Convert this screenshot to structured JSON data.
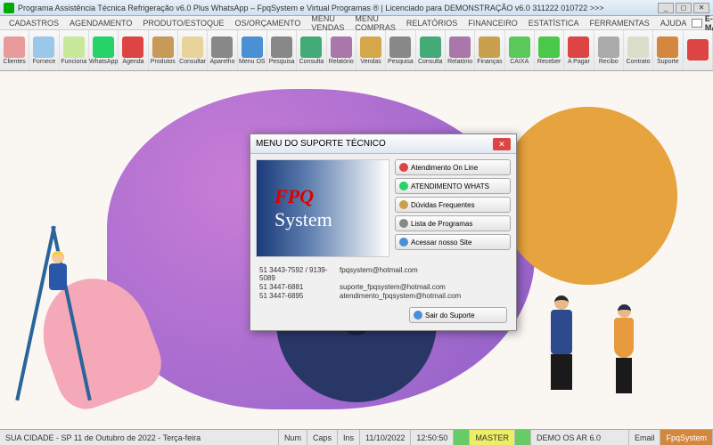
{
  "title": "Programa Assistência Técnica Refrigeração v6.0 Plus WhatsApp – FpqSystem e Virtual Programas ® | Licenciado para  DEMONSTRAÇÃO v6.0 311222 010722 >>>",
  "menu": [
    "CADASTROS",
    "AGENDAMENTO",
    "PRODUTO/ESTOQUE",
    "OS/ORÇAMENTO",
    "MENU VENDAS",
    "MENU COMPRAS",
    "RELATÓRIOS",
    "FINANCEIRO",
    "ESTATÍSTICA",
    "FERRAMENTAS",
    "AJUDA"
  ],
  "email_label": "E-MAIL",
  "toolbar": [
    {
      "label": "Clientes",
      "color": "#e89a9a"
    },
    {
      "label": "Fornece",
      "color": "#9ac8e8"
    },
    {
      "label": "Funciona",
      "color": "#c8e89a"
    },
    {
      "label": "WhatsApp",
      "color": "#25d366"
    },
    {
      "label": "Agenda",
      "color": "#d44"
    },
    {
      "label": "Produtos",
      "color": "#c89a5a"
    },
    {
      "label": "Consultar",
      "color": "#e8d49a"
    },
    {
      "label": "Aparelho",
      "color": "#888"
    },
    {
      "label": "Menu OS",
      "color": "#4a90d4"
    },
    {
      "label": "Pesquisa",
      "color": "#888"
    },
    {
      "label": "Consulta",
      "color": "#4a7"
    },
    {
      "label": "Relatório",
      "color": "#a7a"
    },
    {
      "label": "Vendas",
      "color": "#d4a84a"
    },
    {
      "label": "Pesquisa",
      "color": "#888"
    },
    {
      "label": "Consulta",
      "color": "#4a7"
    },
    {
      "label": "Relatório",
      "color": "#a7a"
    },
    {
      "label": "Finanças",
      "color": "#c8a050"
    },
    {
      "label": "CAIXA",
      "color": "#5ac85a"
    },
    {
      "label": "Receber",
      "color": "#4ac84a"
    },
    {
      "label": "A Pagar",
      "color": "#d44"
    },
    {
      "label": "Recibo",
      "color": "#aaa"
    },
    {
      "label": "Contrato",
      "color": "#ddc"
    },
    {
      "label": "Suporte",
      "color": "#d4883f"
    },
    {
      "label": "",
      "color": "#d44"
    }
  ],
  "dialog": {
    "title": "MENU DO SUPORTE TÉCNICO",
    "logo1": "FPQ",
    "logo2": "System",
    "buttons": [
      {
        "label": "Atendimento On Line",
        "icon": "#d44"
      },
      {
        "label": "ATENDIMENTO WHATS",
        "icon": "#25d366"
      },
      {
        "label": "Dúvidas Frequentes",
        "icon": "#c8a050"
      },
      {
        "label": "Lista de Programas",
        "icon": "#888"
      },
      {
        "label": "Acessar nosso Site",
        "icon": "#4a90d4"
      }
    ],
    "exit": "Sair do Suporte",
    "contacts": [
      {
        "phone": "51 3443-7592 / 9139-5089",
        "email": "fpqsystem@hotmail.com"
      },
      {
        "phone": "51 3447-6881",
        "email": "suporte_fpqsystem@hotmail.com"
      },
      {
        "phone": "51 3447-6895",
        "email": "atendimento_fpqsystem@hotmail.com"
      }
    ]
  },
  "status": {
    "location": "SUA CIDADE - SP 11 de Outubro de 2022 - Terça-feira",
    "num": "Num",
    "caps": "Caps",
    "ins": "Ins",
    "date": "11/10/2022",
    "time": "12:50:50",
    "user": "MASTER",
    "version": "DEMO OS AR 6.0",
    "email": "Email",
    "brand": "FpqSystem"
  }
}
